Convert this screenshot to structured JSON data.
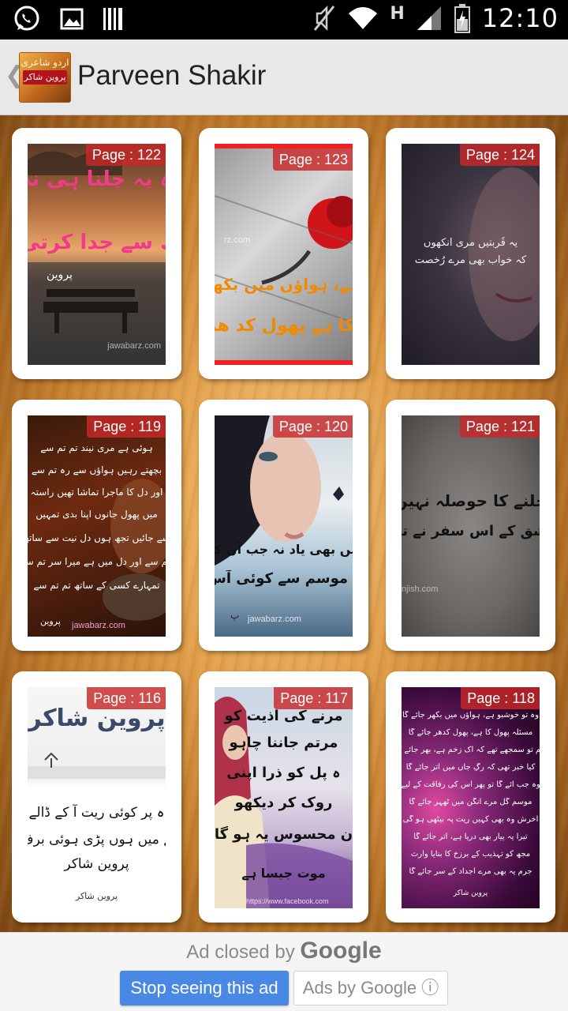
{
  "status_bar": {
    "time": "12:10",
    "network_label": "H",
    "left_icons": [
      "whatsapp-icon",
      "image-icon",
      "barcode-icon"
    ],
    "right_icons": [
      "mute-icon",
      "wifi-icon",
      "signal-icon",
      "battery-icon"
    ]
  },
  "action_bar": {
    "back_glyph": "❮",
    "logo_line1": "اردو شاعری",
    "logo_line2": "پروین شاکر",
    "title": "Parveen Shakir"
  },
  "pages": [
    {
      "label": "Page : 122",
      "urdu_lines": [
        "کو اس راہ پہ چلنا ہی نہ",
        "ہے تجھ سے جدا کرتی"
      ],
      "signature": "پروین",
      "watermark": "jawabarz.com"
    },
    {
      "label": "Page : 123",
      "urdu_lines": [
        "ہے، ہواؤں میں بکھ",
        "ں کا ہے پھول کد ھر"
      ],
      "signature": "",
      "watermark": "rz.com"
    },
    {
      "label": "Page : 124",
      "urdu_lines": [
        "یہ قُربتیں مری آنکھوں",
        "کہ خواب بھی مرے رُخصت"
      ],
      "signature": "",
      "watermark": ""
    },
    {
      "label": "Page : 119",
      "urdu_lines": [
        "ہوئی ہے مری نیند تم تم سے",
        "بچھتے رہیں ہواؤں سے رہ تم سے",
        "اور دل کا ماجرا تماشا تھیں راستہ",
        "میں پھول جانوں اپنا بدی تمہیں",
        "سے جائیں تجھ ہوں دل نیت سے ساتھ",
        "ہم سے اور دل میں ہے میرا سر تم سے",
        "تمہارے کسی کے ساتھ تم تم سے"
      ],
      "signature": "پروین",
      "watermark": "jawabarz.com"
    },
    {
      "label": "Page : 120",
      "urdu_lines": [
        "میں بھی یاد نہ جب اُن کو",
        "ن سے موسم سے کوئی آس"
      ],
      "signature": "پ",
      "watermark": "jawabarz.com"
    },
    {
      "label": "Page : 121",
      "urdu_lines": [
        "چلنے کا حوصلہ نہیں",
        "عشق کے اس سفر نے تو"
      ],
      "signature": "",
      "watermark": "njish.com"
    },
    {
      "label": "Page : 116",
      "urdu_lines": [
        "پروین شاکر",
        "ہ پر کوئی ریت آ کے ڈالے",
        "زمانے میں ہوں پڑی ہوئی برف",
        "پروین شاکر"
      ],
      "signature": "پروین شاکر",
      "watermark": ""
    },
    {
      "label": "Page : 117",
      "urdu_lines": [
        "مرنے کی اذیت کو",
        "مرتم جاننا چاہو",
        "ہ پل کو ذرا اپنی",
        "روک کر دیکھو",
        "ن محسوس یہ ہو گا",
        "موت جیسا ہے"
      ],
      "signature": "",
      "watermark": "https://www.facebook.com"
    },
    {
      "label": "Page : 118",
      "urdu_lines": [
        "وہ تو خوشبو ہے، ہواؤں میں بکھر جائے گا",
        "مسئلہ پھول کا ہے، پھول کدھر جائے گا",
        "ہم تو سمجھے تھے کہ اک زخم ہے، بھر جائے گا",
        "کیا خبر تھی کہ رگِ جاں میں اتر جائے گا",
        "وہ جب آئے گا تو پھر اس کی رفاقت کے لیے",
        "موسمِ گل مرے آنگن میں ٹھہر جائے گا",
        "آخرش وہ بھی کہیں ریت پہ بیٹھی ہو گی",
        "تیرا یہ پیار بھی دریا ہے، اتر جائے گا",
        "مجھ کو تہذیب کے برزخ کا بنایا وارث",
        "جرم یہ بھی مرے اجداد کے سر جائے گا",
        "پروین شاکر"
      ],
      "signature": "پروین شاکر",
      "watermark": ""
    }
  ],
  "ad": {
    "closed_text": "Ad closed by",
    "brand": "Google",
    "stop_label": "Stop seeing this ad",
    "adsby_label": "Ads by Google ⓘ"
  }
}
